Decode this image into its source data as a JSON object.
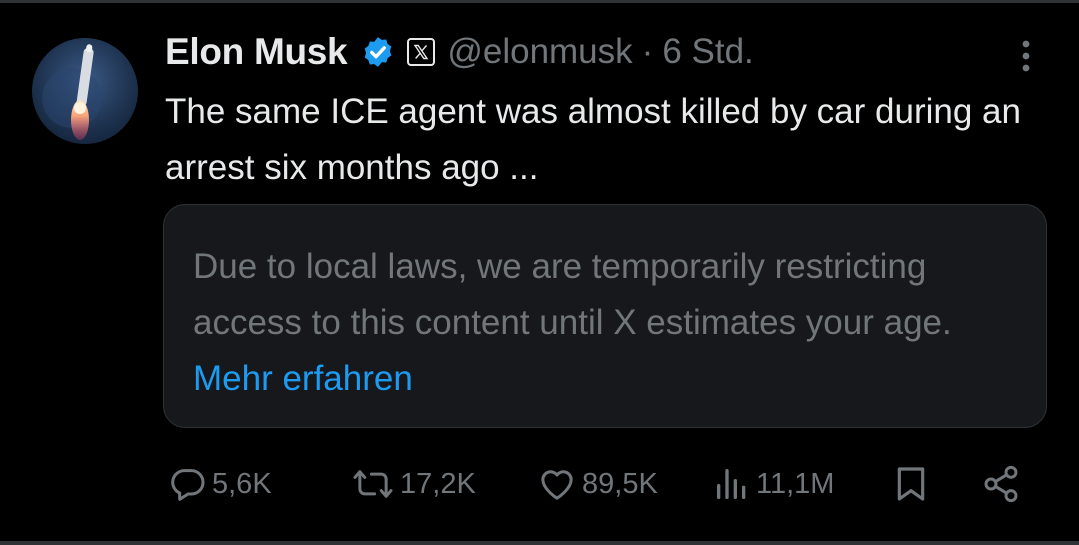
{
  "author": {
    "name": "Elon Musk",
    "handle": "@elonmusk",
    "separator": "·",
    "time": "6 Std."
  },
  "tweet": {
    "text": "The same ICE agent was almost killed by car during an arrest six months ago ..."
  },
  "notice": {
    "text": "Due to local laws, we are temporarily restricting access to this content until X estimates your age.",
    "link": "Mehr erfahren"
  },
  "actions": {
    "replies": "5,6K",
    "reposts": "17,2K",
    "likes": "89,5K",
    "views": "11,1M"
  },
  "colors": {
    "background": "#000000",
    "text": "#e7e9ea",
    "muted": "#71767b",
    "link": "#1d9bf0",
    "verified": "#1d9bf0",
    "card": "#16181c"
  },
  "icons": {
    "verified": "verified-badge-icon",
    "affiliate": "x-logo-icon",
    "more": "more-vertical-icon",
    "reply": "reply-icon",
    "repost": "repost-icon",
    "like": "heart-icon",
    "views": "views-icon",
    "bookmark": "bookmark-icon",
    "share": "share-icon"
  }
}
